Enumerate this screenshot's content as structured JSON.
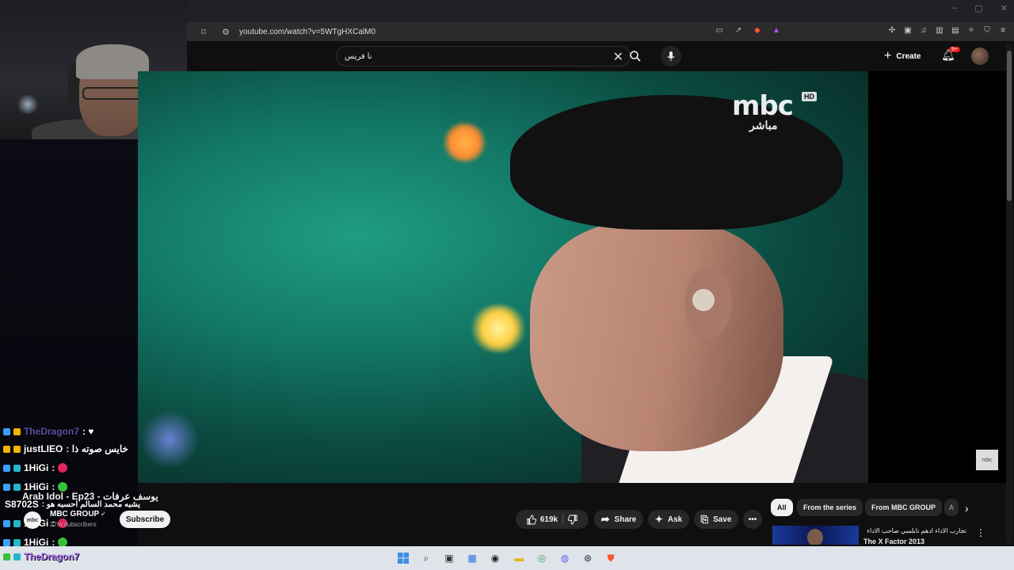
{
  "browser": {
    "url": "youtube.com/watch?v=5WTgHXCalM0",
    "window_controls": [
      "–",
      "▢",
      "✕"
    ]
  },
  "youtube_header": {
    "search_value": "نا فريس",
    "create_label": "Create",
    "notification_count": "9+"
  },
  "video": {
    "channel_logo_text": "mbc",
    "channel_logo_sub": "مباشر",
    "hd_badge": "HD",
    "watermark": "mbc"
  },
  "below_video": {
    "title": "Arab Idol - Ep23 - يوسف عرفات",
    "channel_name": "MBC GROUP",
    "subscribers": "27m subscribers",
    "subscribe_label": "Subscribe",
    "likes": "619k",
    "share_label": "Share",
    "ask_label": "Ask",
    "save_label": "Save"
  },
  "chips": {
    "all": "All",
    "from_series": "From the series",
    "from_channel": "From MBC GROUP",
    "more": "A"
  },
  "suggestion": {
    "title_line1": "تجارب الاداء ادهم نابلسي صاحب الاداء",
    "title_line2": "The X Factor 2013"
  },
  "chat": [
    {
      "user": "TheDragon7",
      "msg": ": ♥",
      "user_color": "#9a7bff"
    },
    {
      "user": "justLIEO",
      "msg": ": خايس صوته ذا",
      "user_color": "#ffffff"
    },
    {
      "user": "1HiGi",
      "msg": ":",
      "user_color": "#ffffff"
    },
    {
      "user": "1HiGi",
      "msg": ":",
      "user_color": "#ffffff"
    },
    {
      "user": "S8702S",
      "msg": ": يشبه محمد السالم احسبه هو",
      "user_color": "#ffffff"
    },
    {
      "user": "1HiGi",
      "msg": ":",
      "user_color": "#ffffff"
    },
    {
      "user": "1HiGi",
      "msg": ":",
      "user_color": "#ffffff"
    },
    {
      "user": "TheDragon7",
      "msg": "",
      "user_color": "#b37bff"
    }
  ],
  "colors": {
    "youtube_bg": "#0f0f0f",
    "pill_bg": "#272727",
    "chat_purple": "#9a7bff"
  }
}
